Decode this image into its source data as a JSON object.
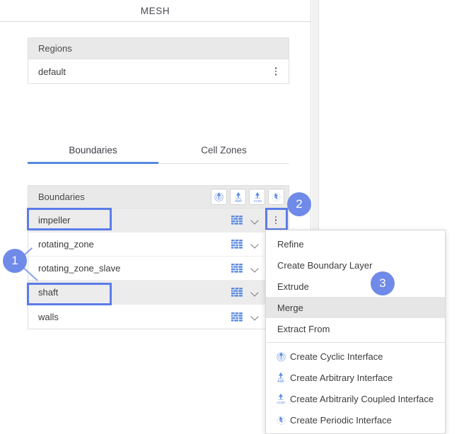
{
  "panel": {
    "title": "MESH"
  },
  "regions": {
    "header": "Regions",
    "rows": [
      {
        "label": "default",
        "menu_icon": "kebab-icon"
      }
    ]
  },
  "tabs": [
    {
      "label": "Boundaries",
      "active": true
    },
    {
      "label": "Cell Zones",
      "active": false
    }
  ],
  "boundaries": {
    "header": "Boundaries",
    "toolbar": [
      {
        "name": "create-cyclic-interface-button",
        "icon": "cyclic-interface-icon",
        "label": ""
      },
      {
        "name": "create-arbitrary-interface-button",
        "icon": "ami-icon",
        "label": "AMI"
      },
      {
        "name": "create-arbitrarily-coupled-interface-button",
        "icon": "acmi-icon",
        "label": "ACMI"
      },
      {
        "name": "create-periodic-interface-button",
        "icon": "periodic-interface-icon",
        "label": ""
      }
    ],
    "rows": [
      {
        "label": "impeller",
        "shaded": true,
        "highlighted": true,
        "mesh_icon": "brick-wall-icon",
        "expand_icon": "chevron-down-icon",
        "menu_icon": "kebab-icon"
      },
      {
        "label": "rotating_zone",
        "shaded": false,
        "highlighted": false,
        "mesh_icon": "brick-wall-icon",
        "expand_icon": "chevron-down-icon",
        "menu_icon": "kebab-icon"
      },
      {
        "label": "rotating_zone_slave",
        "shaded": false,
        "highlighted": false,
        "mesh_icon": "brick-wall-icon",
        "expand_icon": "chevron-down-icon",
        "menu_icon": "kebab-icon"
      },
      {
        "label": "shaft",
        "shaded": true,
        "highlighted": true,
        "mesh_icon": "brick-wall-icon",
        "expand_icon": "chevron-down-icon",
        "menu_icon": "kebab-icon"
      },
      {
        "label": "walls",
        "shaded": false,
        "highlighted": false,
        "mesh_icon": "brick-wall-icon",
        "expand_icon": "chevron-down-icon",
        "menu_icon": "kebab-icon"
      }
    ]
  },
  "context_menu": {
    "items": [
      {
        "label": "Refine",
        "icon": null,
        "highlighted": false
      },
      {
        "label": "Create Boundary Layer",
        "icon": null,
        "highlighted": false
      },
      {
        "label": "Extrude",
        "icon": null,
        "highlighted": false
      },
      {
        "label": "Merge",
        "icon": null,
        "highlighted": true
      },
      {
        "label": "Extract From",
        "icon": null,
        "highlighted": false
      }
    ],
    "interface_items": [
      {
        "label": "Create Cyclic Interface",
        "icon": "cyclic-interface-icon",
        "icon_text": ""
      },
      {
        "label": "Create Arbitrary Interface",
        "icon": "ami-icon",
        "icon_text": "AMI"
      },
      {
        "label": "Create Arbitrarily Coupled Interface",
        "icon": "acmi-icon",
        "icon_text": "ACMI"
      },
      {
        "label": "Create Periodic Interface",
        "icon": "periodic-interface-icon",
        "icon_text": ""
      }
    ]
  },
  "badges": [
    {
      "number": "1"
    },
    {
      "number": "2"
    },
    {
      "number": "3"
    }
  ],
  "colors": {
    "accent_blue": "#5b7ce8",
    "badge_blue": "#6f8ae8",
    "tab_underline": "#5588e3",
    "icon_blue": "#5b8ae0",
    "header_gray": "#e9e9e9",
    "row_shaded": "#ececec",
    "menu_highlight": "#e6e6e6"
  }
}
